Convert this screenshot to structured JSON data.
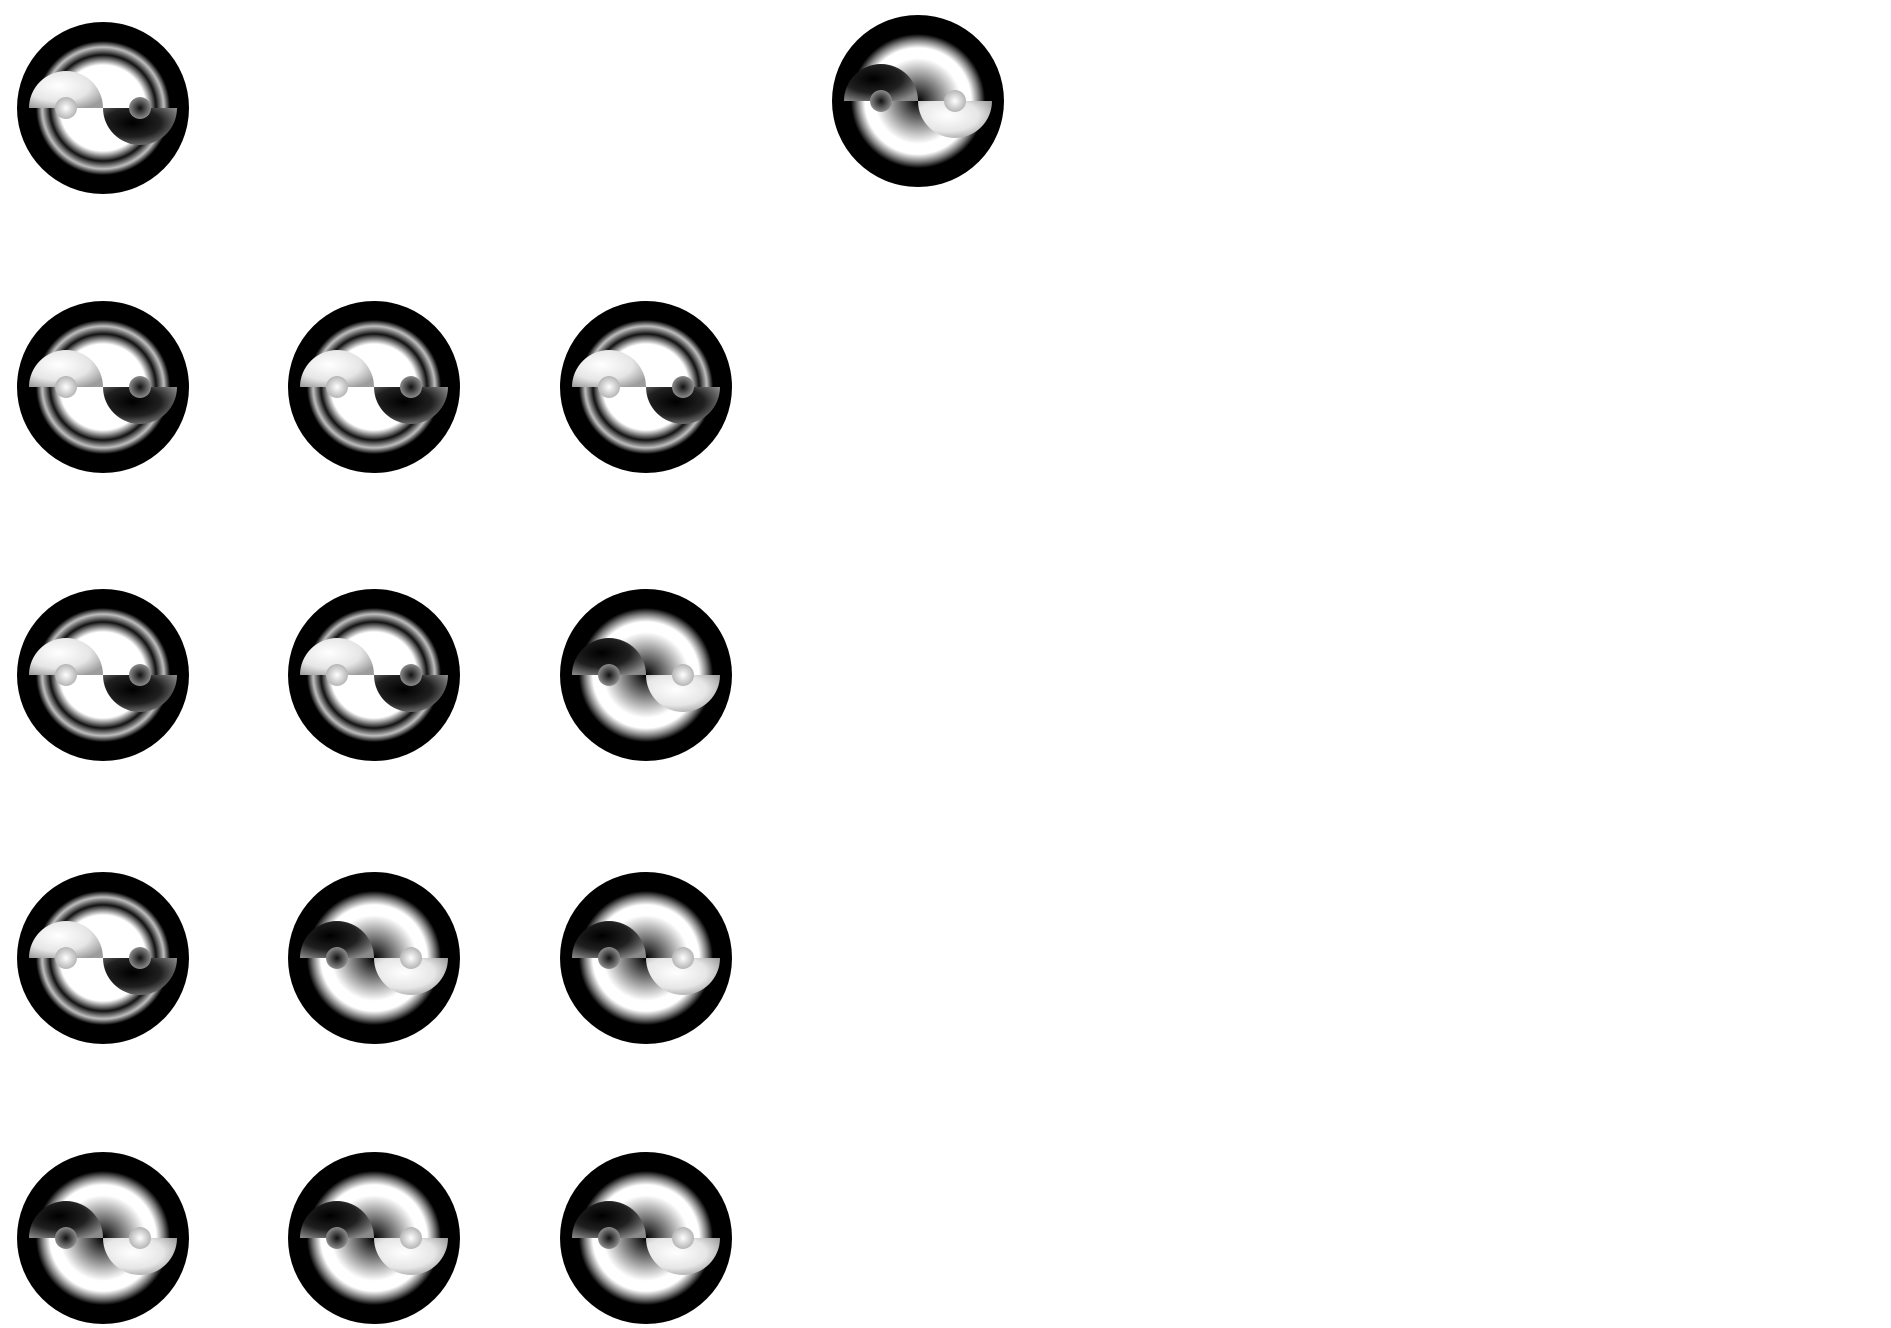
{
  "board": {
    "background": "#ffffff",
    "colors": {
      "ring": "#000000",
      "light": "#ffffff",
      "dark": "#000000"
    },
    "rows": [
      {
        "name": "row-1",
        "pieces": [
          "light-left",
          null,
          null,
          "dark-left"
        ]
      },
      {
        "name": "row-2",
        "pieces": [
          "light-left",
          "light-left",
          "light-left"
        ]
      },
      {
        "name": "row-3",
        "pieces": [
          "light-left",
          "light-left",
          "dark-left"
        ]
      },
      {
        "name": "row-4",
        "pieces": [
          "light-left",
          "dark-left",
          "dark-left"
        ]
      },
      {
        "name": "row-5",
        "pieces": [
          "dark-left",
          "dark-left",
          "dark-left"
        ]
      }
    ]
  }
}
